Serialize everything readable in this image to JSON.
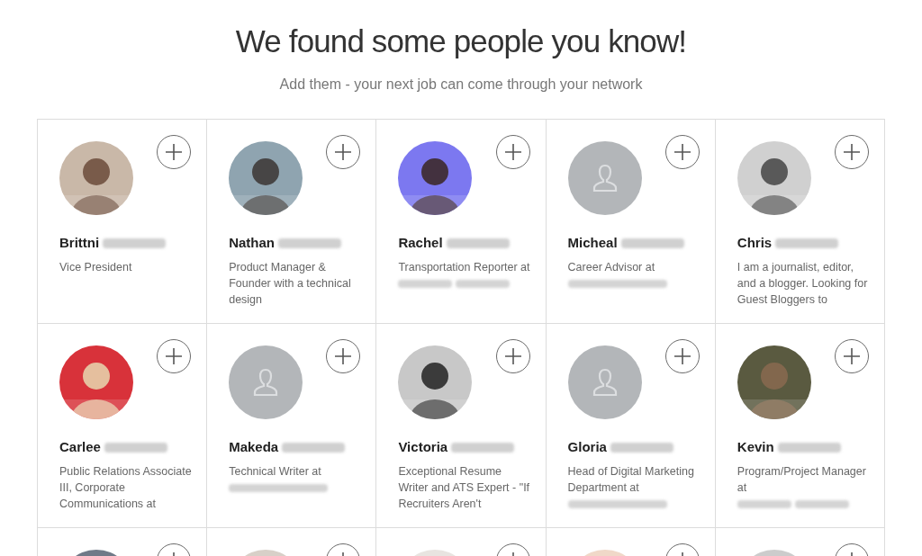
{
  "heading": {
    "title": "We found some people you know!",
    "subtitle": "Add them - your next job can come through your network"
  },
  "people": [
    {
      "has_photo": true,
      "first_name": "Brittni",
      "surname_blurred": true,
      "headline": [
        {
          "kind": "text",
          "text": "Vice President"
        }
      ]
    },
    {
      "has_photo": true,
      "first_name": "Nathan",
      "surname_blurred": true,
      "headline": [
        {
          "kind": "text",
          "text": "Product Manager & Founder with a technical design"
        }
      ]
    },
    {
      "has_photo": true,
      "first_name": "Rachel",
      "surname_blurred": true,
      "headline": [
        {
          "kind": "text",
          "text": "Transportation Reporter at"
        },
        {
          "kind": "blurred_word"
        },
        {
          "kind": "blurred_word"
        }
      ]
    },
    {
      "has_photo": false,
      "first_name": "Micheal",
      "surname_blurred": true,
      "headline": [
        {
          "kind": "text",
          "text": "Career Advisor at"
        },
        {
          "kind": "blurred_line"
        }
      ]
    },
    {
      "has_photo": true,
      "first_name": "Chris",
      "surname_blurred": true,
      "headline": [
        {
          "kind": "text",
          "text": "I am a journalist, editor, and a blogger. Looking for Guest Bloggers to"
        }
      ]
    },
    {
      "has_photo": true,
      "first_name": "Carlee",
      "surname_blurred": true,
      "headline": [
        {
          "kind": "text",
          "text": "Public Relations Associate III, Corporate Communications at"
        }
      ]
    },
    {
      "has_photo": false,
      "first_name": "Makeda",
      "surname_blurred": true,
      "headline": [
        {
          "kind": "text",
          "text": "Technical Writer at"
        },
        {
          "kind": "blurred_line"
        }
      ]
    },
    {
      "has_photo": true,
      "first_name": "Victoria",
      "surname_blurred": true,
      "headline": [
        {
          "kind": "text",
          "text": "Exceptional Resume Writer and ATS Expert - \"If Recruiters Aren't"
        }
      ]
    },
    {
      "has_photo": false,
      "first_name": "Gloria",
      "surname_blurred": true,
      "headline": [
        {
          "kind": "text",
          "text": "Head of Digital Marketing Department at"
        },
        {
          "kind": "blurred_line"
        }
      ]
    },
    {
      "has_photo": true,
      "first_name": "Kevin",
      "surname_blurred": true,
      "headline": [
        {
          "kind": "text",
          "text": "Program/Project Manager at"
        },
        {
          "kind": "blurred_word"
        },
        {
          "kind": "blurred_word"
        }
      ]
    },
    {
      "has_photo": true
    },
    {
      "has_photo": true
    },
    {
      "has_photo": true
    },
    {
      "has_photo": true
    },
    {
      "has_photo": true
    }
  ]
}
